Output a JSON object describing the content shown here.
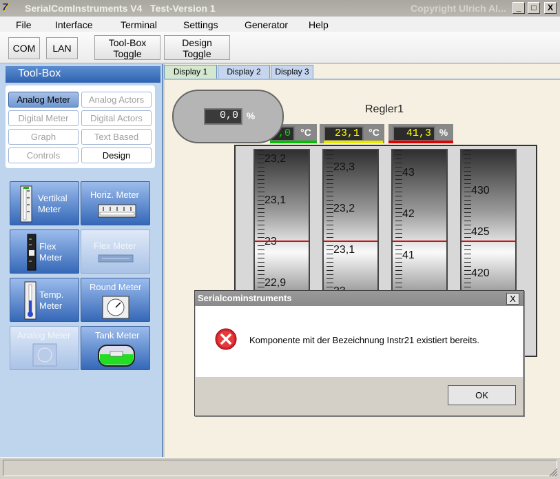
{
  "window": {
    "title": "SerialComInstruments V4   Test-Version 1",
    "copyright": "Copyright Ulrich Al...",
    "logo_text": "7"
  },
  "window_controls": {
    "minimize": "_",
    "maximize": "□",
    "close": "X"
  },
  "menu": [
    "File",
    "Interface",
    "Terminal",
    "Settings",
    "Generator",
    "Help"
  ],
  "toolbar": {
    "com": "COM",
    "lan": "LAN",
    "toolbox_toggle": [
      "Tool-Box",
      "Toggle"
    ],
    "design_toggle": [
      "Design",
      "Toggle"
    ]
  },
  "toolbox": {
    "title": "Tool-Box",
    "categories": [
      {
        "label": "Analog Meter",
        "state": "selected"
      },
      {
        "label": "Analog Actors",
        "state": "disabled"
      },
      {
        "label": "Digital Meter",
        "state": "disabled"
      },
      {
        "label": "Digital Actors",
        "state": "disabled"
      },
      {
        "label": "Graph",
        "state": "disabled"
      },
      {
        "label": "Text Based",
        "state": "disabled"
      },
      {
        "label": "Controls",
        "state": "disabled"
      },
      {
        "label": "Design",
        "state": "active"
      }
    ],
    "tiles": [
      {
        "label": [
          "Vertikal",
          "Meter"
        ],
        "enabled": true,
        "icon": "vertical-meter-icon"
      },
      {
        "label": [
          "Horiz. Meter"
        ],
        "enabled": true,
        "icon": "horizontal-meter-icon"
      },
      {
        "label": [
          "Flex",
          "Meter"
        ],
        "enabled": true,
        "icon": "flex-meter-icon"
      },
      {
        "label": [
          "Flex Meter"
        ],
        "enabled": false,
        "icon": "flex-meter-bar-icon"
      },
      {
        "label": [
          "Temp.",
          "Meter"
        ],
        "enabled": true,
        "icon": "thermometer-icon"
      },
      {
        "label": [
          "Round Meter"
        ],
        "enabled": true,
        "icon": "round-meter-icon"
      },
      {
        "label": [
          "Analog Meter"
        ],
        "enabled": false,
        "icon": "analog-meter-icon"
      },
      {
        "label": [
          "Tank Meter"
        ],
        "enabled": true,
        "icon": "tank-meter-icon"
      }
    ]
  },
  "tabs": [
    "Display 1",
    "Display 2",
    "Display 3"
  ],
  "active_tab": 0,
  "gauge_small": {
    "value": "0,0",
    "unit": "%"
  },
  "regler": {
    "title": "Regler1",
    "readouts": [
      {
        "value": ",0",
        "unit": "°C",
        "color": "#00e000",
        "bar": "#00c000"
      },
      {
        "value": "23,1",
        "unit": "°C",
        "color": "#ffff00",
        "bar": "#e8e800"
      },
      {
        "value": "41,3",
        "unit": "%",
        "color": "#ffff00",
        "bar": "#e00000"
      }
    ],
    "scales": [
      {
        "ticks": [
          "23,2",
          "23,1",
          "23",
          "22,9"
        ]
      },
      {
        "ticks": [
          "23,3",
          "23,2",
          "23,1",
          "23"
        ]
      },
      {
        "ticks": [
          "43",
          "42",
          "41",
          ""
        ]
      },
      {
        "ticks": [
          "430",
          "425",
          "420",
          ""
        ]
      }
    ]
  },
  "dialog": {
    "title": "Serialcominstruments",
    "message": "Komponente mit der Bezeichnung Instr21 existiert bereits.",
    "ok": "OK",
    "close": "X"
  }
}
